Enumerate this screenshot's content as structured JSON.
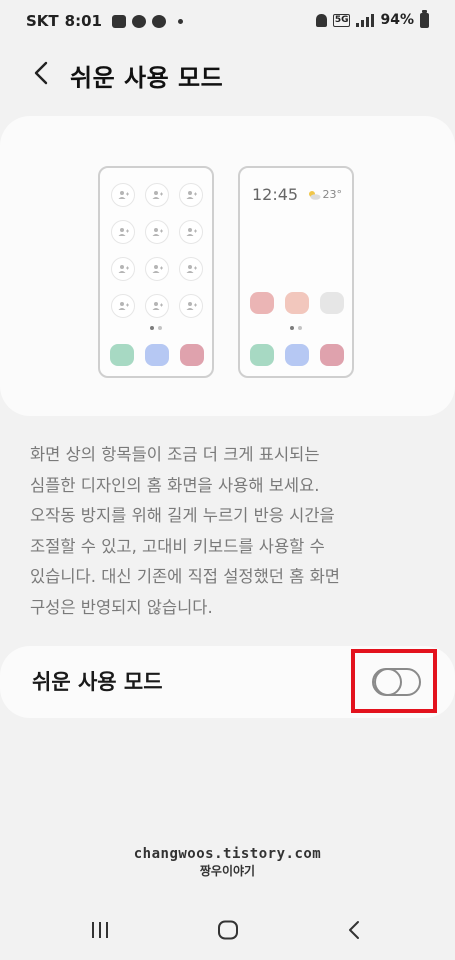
{
  "status_bar": {
    "carrier": "SKT",
    "time": "8:01",
    "battery": "94%",
    "network_badge": "5G"
  },
  "header": {
    "title": "쉬운 사용 모드",
    "back_icon": "chevron-left-icon"
  },
  "preview": {
    "clock": "12:45",
    "weather": "23°",
    "dock_colors": [
      "#a7d9c3",
      "#b6c8f3",
      "#dfa2ad"
    ],
    "middle_row_colors": [
      "#ebb5b5",
      "#f2c7bd",
      "#e6e6e6"
    ]
  },
  "description": [
    "화면 상의 항목들이 조금 더 크게 표시되는",
    "심플한 디자인의 홈 화면을 사용해 보세요.",
    "오작동 방지를 위해 길게 누르기 반응 시간을",
    "조절할 수 있고, 고대비 키보드를 사용할 수",
    "있습니다. 대신 기존에 직접 설정했던 홈 화면",
    "구성은 반영되지 않습니다."
  ],
  "setting": {
    "label": "쉬운 사용 모드",
    "enabled": false
  },
  "watermark": {
    "line1": "changwoos.tistory.com",
    "line2": "짱우이야기"
  },
  "navbar": {
    "recent_icon": "recent-apps-icon",
    "home_icon": "home-icon",
    "back_icon": "back-icon"
  },
  "colors": {
    "background": "#f2f2f2",
    "card": "#fbfbfb",
    "highlight": "#e3121d"
  }
}
